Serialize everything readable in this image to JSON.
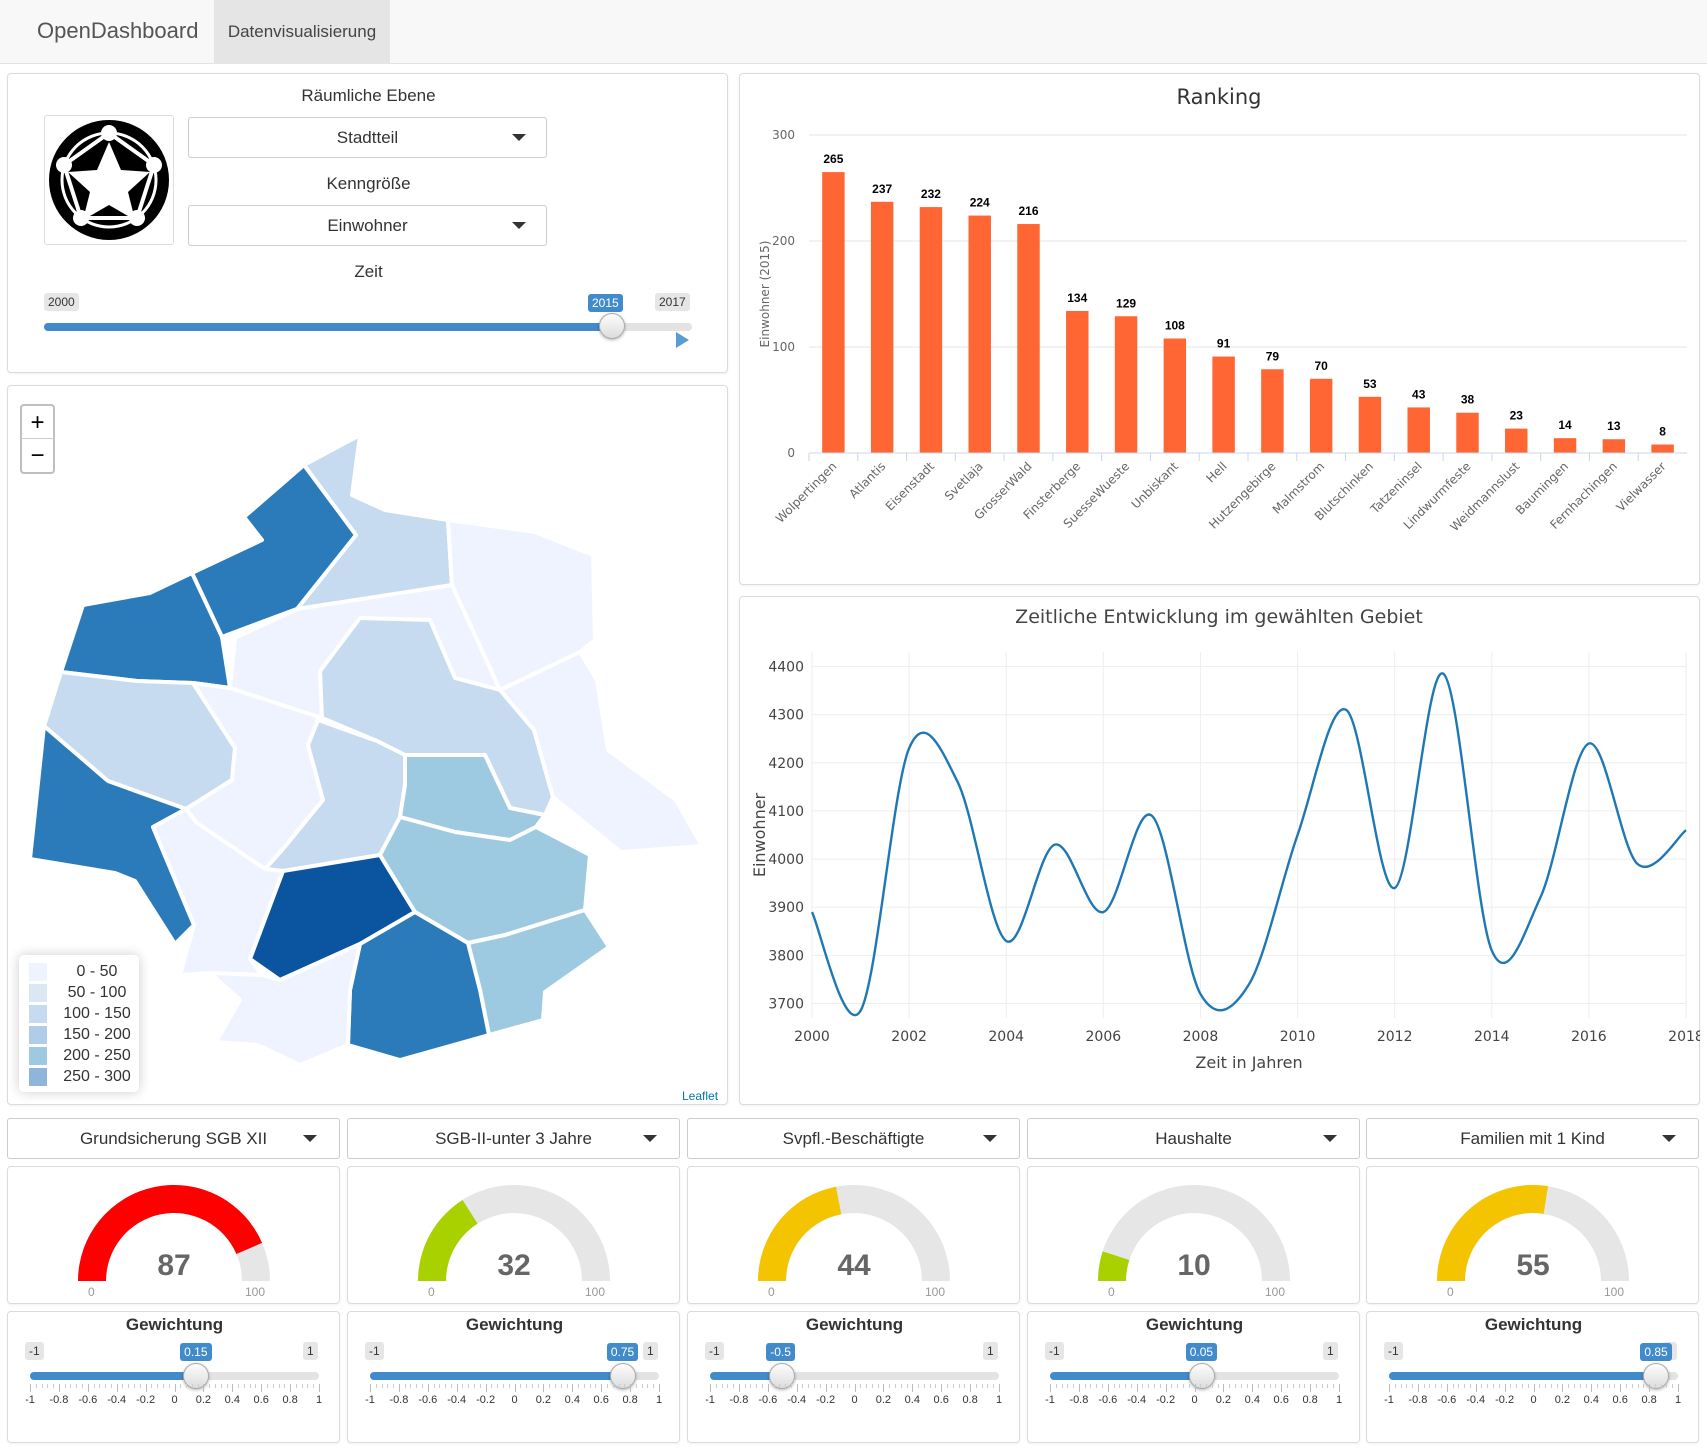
{
  "navbar": {
    "brand": "OpenDashboard",
    "tab": "Datenvisualisierung"
  },
  "controls": {
    "spatial_label": "Räumliche Ebene",
    "spatial_value": "Stadtteil",
    "metric_label": "Kenngröße",
    "metric_value": "Einwohner",
    "time_label": "Zeit",
    "time_min": "2000",
    "time_max": "2017",
    "time_value": "2015",
    "time_fraction": 0.882
  },
  "map": {
    "zoom_in": "+",
    "zoom_out": "−",
    "attribution": "Leaflet",
    "legend": [
      {
        "label": "0 - 50",
        "color": "#eff3ff"
      },
      {
        "label": "50 - 100",
        "color": "#dbe7f5"
      },
      {
        "label": "100 - 150",
        "color": "#c6dbef"
      },
      {
        "label": "150 - 200",
        "color": "#afcde7"
      },
      {
        "label": "200 - 250",
        "color": "#9ecae1"
      },
      {
        "label": "250 - 300",
        "color": "#8fb6da"
      }
    ]
  },
  "chart_data": [
    {
      "type": "bar",
      "title": "Ranking",
      "ylabel": "Einwohner (2015)",
      "ylim": [
        0,
        300
      ],
      "yticks": [
        0,
        100,
        200,
        300
      ],
      "color": "#ff6633",
      "categories": [
        "Wolpertingen",
        "Atlantis",
        "Eisenstadt",
        "Svetlaja",
        "GrosserWald",
        "Finsterberge",
        "SuesseWueste",
        "Unbiskant",
        "Hell",
        "Hutzengebirge",
        "Malmstrom",
        "Blutschinken",
        "Tatzeninsel",
        "Lindwurmfeste",
        "Weidmannslust",
        "Baumingen",
        "Fernhachingen",
        "Vielwasser"
      ],
      "values": [
        265,
        237,
        232,
        224,
        216,
        134,
        129,
        108,
        91,
        79,
        70,
        53,
        43,
        38,
        23,
        14,
        13,
        8
      ]
    },
    {
      "type": "line",
      "title": "Zeitliche Entwicklung im gewählten Gebiet",
      "xlabel": "Zeit in Jahren",
      "ylabel": "Einwohner",
      "xlim": [
        2000,
        2018
      ],
      "ylim": [
        3670,
        4430
      ],
      "xticks": [
        2000,
        2002,
        2004,
        2006,
        2008,
        2010,
        2012,
        2014,
        2016,
        2018
      ],
      "yticks": [
        3700,
        3800,
        3900,
        4000,
        4100,
        4200,
        4300,
        4400
      ],
      "color": "#1f77b4",
      "x": [
        2000,
        2001,
        2002,
        2003,
        2004,
        2005,
        2006,
        2007,
        2008,
        2009,
        2010,
        2011,
        2012,
        2013,
        2014,
        2015,
        2016,
        2017,
        2018
      ],
      "y": [
        3890,
        3685,
        4230,
        4160,
        3830,
        4030,
        3890,
        4090,
        3720,
        3740,
        4050,
        4310,
        3940,
        4385,
        3810,
        3920,
        4240,
        3990,
        4060
      ]
    }
  ],
  "indicators": [
    {
      "label": "Grundsicherung SGB XII",
      "value": 87,
      "display": "87",
      "color": "#ff0000",
      "weight": "0.15",
      "weight_value": 0.15
    },
    {
      "label": "SGB-II-unter 3 Jahre",
      "value": 32,
      "display": "32",
      "color": "#a9d100",
      "weight": "0.75",
      "weight_value": 0.75
    },
    {
      "label": "Svpfl.-Beschäftigte",
      "value": 44,
      "display": "44",
      "color": "#f5c400",
      "weight": "-0.5",
      "weight_value": -0.5
    },
    {
      "label": "Haushalte",
      "value": 10,
      "display": "10",
      "color": "#a9d100",
      "weight": "0.05",
      "weight_value": 0.05
    },
    {
      "label": "Familien mit 1 Kind",
      "value": 55,
      "display": "55",
      "color": "#f5c400",
      "weight": "0.85",
      "weight_value": 0.85
    }
  ],
  "gauge": {
    "min": "0",
    "max": "100"
  },
  "weights": {
    "title": "Gewichtung",
    "min": "-1",
    "max": "1",
    "ticks": [
      "-1",
      "-0.8",
      "-0.6",
      "-0.4",
      "-0.2",
      "0",
      "0.2",
      "0.4",
      "0.6",
      "0.8",
      "1"
    ]
  }
}
